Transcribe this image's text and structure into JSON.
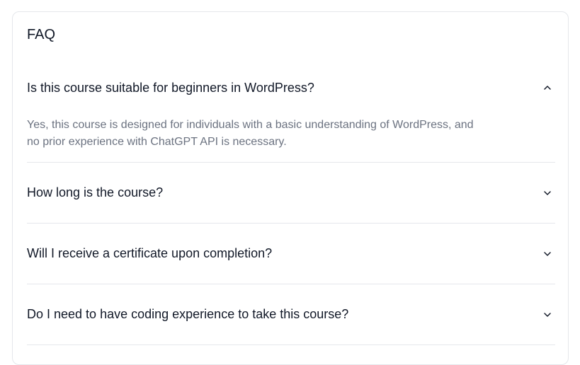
{
  "faq": {
    "title": "FAQ",
    "items": [
      {
        "question": "Is this course suitable for beginners in WordPress?",
        "answer": "Yes, this course is designed for individuals with a basic understanding of WordPress, and no prior experience with ChatGPT API is necessary.",
        "expanded": true,
        "icon": "chevron-up-icon"
      },
      {
        "question": "How long is the course?",
        "expanded": false,
        "icon": "chevron-down-icon"
      },
      {
        "question": "Will I receive a certificate upon completion?",
        "expanded": false,
        "icon": "chevron-down-icon"
      },
      {
        "question": "Do I need to have coding experience to take this course?",
        "expanded": false,
        "icon": "chevron-down-icon"
      }
    ]
  },
  "colors": {
    "text": "#111827",
    "muted": "#6b7280",
    "border": "#e5e7eb"
  }
}
